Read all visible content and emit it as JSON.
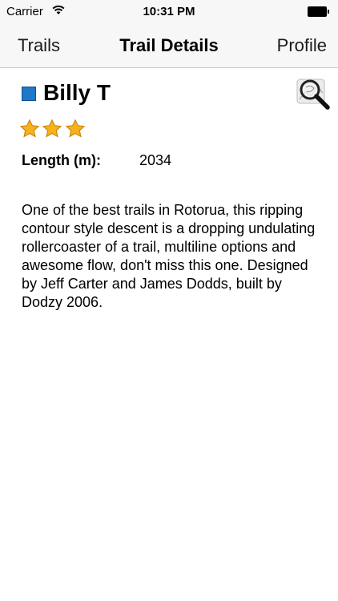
{
  "status_bar": {
    "carrier": "Carrier",
    "time": "10:31 PM",
    "icons": [
      "wifi-icon",
      "battery-icon"
    ]
  },
  "nav_bar": {
    "left_button": "Trails",
    "title": "Trail Details",
    "right_button": "Profile"
  },
  "trail": {
    "name": "Billy T",
    "grade_color": "#1f78c8",
    "rating": 3,
    "length_label": "Length (m):",
    "length_value": "2034",
    "description": "One of the best trails in Rotorua, this ripping contour style descent is a dropping undulating rollercoaster of a trail, multiline options and awesome flow, don't miss this one.  Designed by Jeff Carter and James Dodds, built by Dodzy 2006."
  },
  "colors": {
    "star": "#f6b21a",
    "bar_background": "#f7f7f7"
  },
  "icons": {
    "map_button": "map-magnifier-icon",
    "star": "star-icon"
  }
}
